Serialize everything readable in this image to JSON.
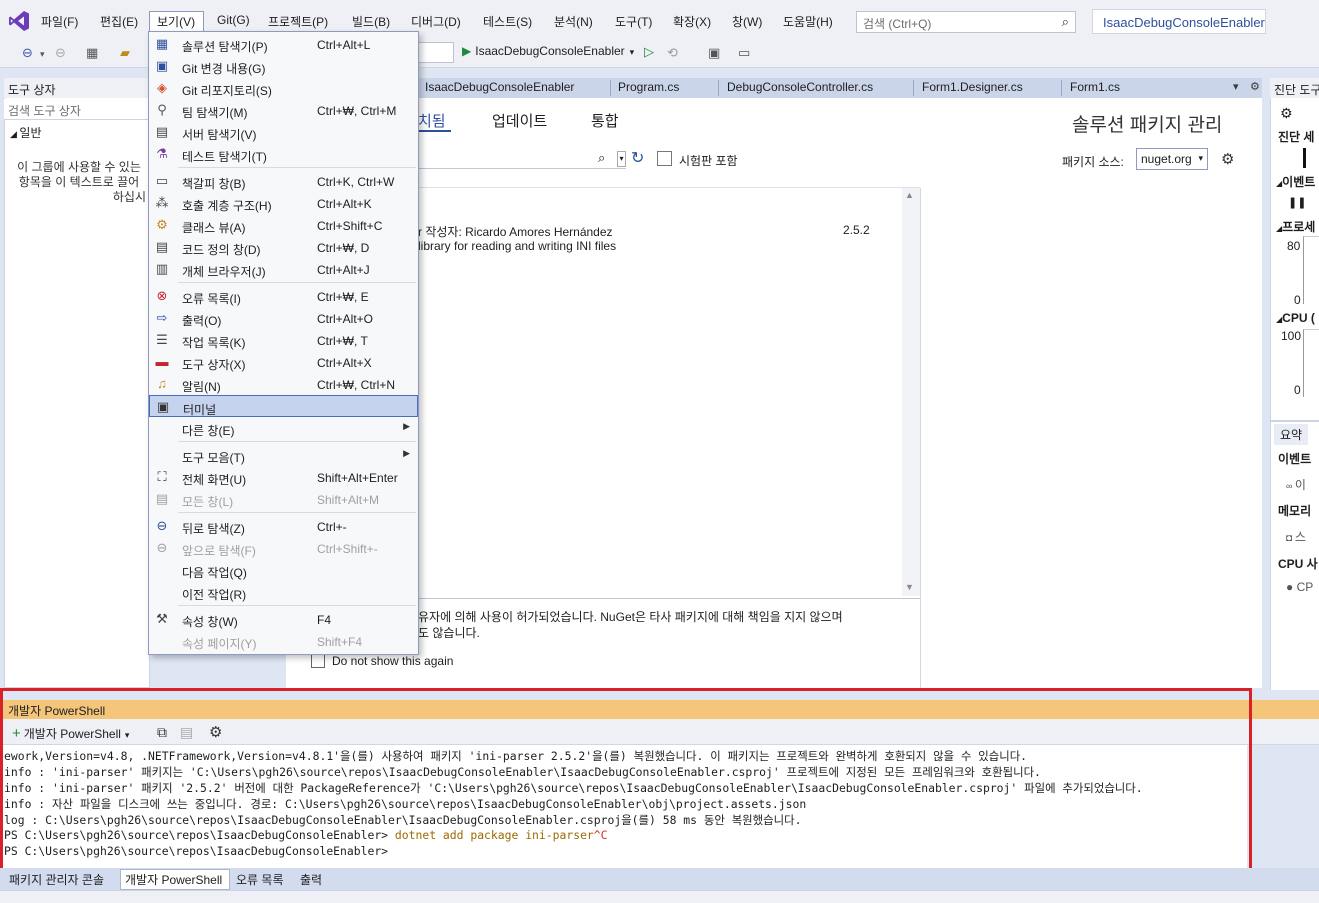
{
  "menubar": {
    "items": [
      "파일(F)",
      "편집(E)",
      "보기(V)",
      "Git(G)",
      "프로젝트(P)",
      "빌드(B)",
      "디버그(D)",
      "테스트(S)",
      "분석(N)",
      "도구(T)",
      "확장(X)",
      "창(W)",
      "도움말(H)"
    ],
    "search_placeholder": "검색 (Ctrl+Q)",
    "solution_title": "IsaacDebugConsoleEnabler"
  },
  "toolbar": {
    "startup_project": "IsaacDebugConsoleEnabler"
  },
  "view_menu": {
    "items": [
      {
        "label": "솔루션 탐색기(P)",
        "shortcut": "Ctrl+Alt+L",
        "icon": "solution-explorer-icon"
      },
      {
        "label": "Git 변경 내용(G)",
        "shortcut": "",
        "icon": "git-changes-icon"
      },
      {
        "label": "Git 리포지토리(S)",
        "shortcut": "",
        "icon": "git-repository-icon"
      },
      {
        "label": "팀 탐색기(M)",
        "shortcut": "Ctrl+₩, Ctrl+M",
        "icon": "team-explorer-icon"
      },
      {
        "label": "서버 탐색기(V)",
        "shortcut": "",
        "icon": "server-explorer-icon"
      },
      {
        "label": "테스트 탐색기(T)",
        "shortcut": "",
        "icon": "test-explorer-icon"
      },
      {
        "label": "책갈피 창(B)",
        "shortcut": "Ctrl+K, Ctrl+W",
        "icon": "bookmark-icon"
      },
      {
        "label": "호출 계층 구조(H)",
        "shortcut": "Ctrl+Alt+K",
        "icon": "call-hierarchy-icon"
      },
      {
        "label": "클래스 뷰(A)",
        "shortcut": "Ctrl+Shift+C",
        "icon": "class-view-icon"
      },
      {
        "label": "코드 정의 창(D)",
        "shortcut": "Ctrl+₩, D",
        "icon": "code-definition-icon"
      },
      {
        "label": "개체 브라우저(J)",
        "shortcut": "Ctrl+Alt+J",
        "icon": "object-browser-icon"
      },
      {
        "label": "오류 목록(I)",
        "shortcut": "Ctrl+₩, E",
        "icon": "error-list-icon"
      },
      {
        "label": "출력(O)",
        "shortcut": "Ctrl+Alt+O",
        "icon": "output-icon"
      },
      {
        "label": "작업 목록(K)",
        "shortcut": "Ctrl+₩, T",
        "icon": "task-list-icon"
      },
      {
        "label": "도구 상자(X)",
        "shortcut": "Ctrl+Alt+X",
        "icon": "toolbox-icon"
      },
      {
        "label": "알림(N)",
        "shortcut": "Ctrl+₩, Ctrl+N",
        "icon": "bell-icon"
      },
      {
        "label": "터미널",
        "shortcut": "",
        "icon": "terminal-icon"
      },
      {
        "label": "다른 창(E)",
        "shortcut": "",
        "icon": ""
      },
      {
        "label": "도구 모음(T)",
        "shortcut": "",
        "icon": ""
      },
      {
        "label": "전체 화면(U)",
        "shortcut": "Shift+Alt+Enter",
        "icon": "fullscreen-icon"
      },
      {
        "label": "모든 창(L)",
        "shortcut": "Shift+Alt+M",
        "icon": "all-windows-icon"
      },
      {
        "label": "뒤로 탐색(Z)",
        "shortcut": "Ctrl+-",
        "icon": "navigate-back-icon"
      },
      {
        "label": "앞으로 탐색(F)",
        "shortcut": "Ctrl+Shift+-",
        "icon": "navigate-forward-icon"
      },
      {
        "label": "다음 작업(Q)",
        "shortcut": "",
        "icon": ""
      },
      {
        "label": "이전 작업(R)",
        "shortcut": "",
        "icon": ""
      },
      {
        "label": "속성 창(W)",
        "shortcut": "F4",
        "icon": "wrench-icon"
      },
      {
        "label": "속성 페이지(Y)",
        "shortcut": "Shift+F4",
        "icon": ""
      }
    ]
  },
  "toolbox": {
    "title": "도구 상자",
    "search_placeholder": "검색 도구 상자",
    "group": "일반",
    "empty_text_1": "이 그룹에 사용할 수 있는",
    "empty_text_2": "항목을 이 텍스트로 끌어",
    "empty_text_3": "하십시"
  },
  "doc_tabs": [
    "IsaacDebugConsoleEnabler",
    "Program.cs",
    "DebugConsoleController.cs",
    "Form1.Designer.cs",
    "Form1.cs"
  ],
  "nuget": {
    "tab_browse": "치됨",
    "tab_updates": "업데이트",
    "tab_consolidate": "통합",
    "title": "솔루션 패키지 관리",
    "prerelease_label": "시험판 포함",
    "source_label": "패키지 소스:",
    "source_value": "nuget.org",
    "package_author_line": "r 작성자: Ricardo Amores Hernández",
    "package_version": "2.5.2",
    "package_description": "library for reading and writing INI files",
    "notice_line_1": "유자에 의해 사용이 허가되었습니다. NuGet은 타사 패키지에 대해 책임을 지지 않으며",
    "notice_line_2": "도 않습니다.",
    "dont_show_label": "Do not show this again"
  },
  "diagnostics": {
    "title": "진단 도구",
    "session_label": "진단 세",
    "events_label": "이벤트",
    "process_label": "프로세",
    "axis_80": "80",
    "axis_0a": "0",
    "cpu_label": "CPU (",
    "axis_100": "100",
    "axis_0b": "0",
    "tab_summary": "요약",
    "section_events": "이벤트",
    "row_events": "이",
    "section_memory": "메모리",
    "row_memory": "스",
    "section_cpu": "CPU 사",
    "row_cpu": "CP"
  },
  "terminal": {
    "title": "개발자 PowerShell",
    "new_terminal_label": "개발자 PowerShell",
    "lines": [
      "ework,Version=v4.8, .NETFramework,Version=v4.8.1'을(를) 사용하여 패키지 'ini-parser 2.5.2'을(를) 복원했습니다. 이 패키지는 프로젝트와 완벽하게 호환되지 않을 수 있습니다.",
      "info : 'ini-parser' 패키지는 'C:\\Users\\pgh26\\source\\repos\\IsaacDebugConsoleEnabler\\IsaacDebugConsoleEnabler.csproj' 프로젝트에 지정된 모든 프레임워크와 호환됩니다.",
      "info : 'ini-parser' 패키지 '2.5.2' 버전에 대한 PackageReference가 'C:\\Users\\pgh26\\source\\repos\\IsaacDebugConsoleEnabler\\IsaacDebugConsoleEnabler.csproj' 파일에 추가되었습니다.",
      "info : 자산 파일을 디스크에 쓰는 중입니다. 경로: C:\\Users\\pgh26\\source\\repos\\IsaacDebugConsoleEnabler\\obj\\project.assets.json",
      "log  : C:\\Users\\pgh26\\source\\repos\\IsaacDebugConsoleEnabler\\IsaacDebugConsoleEnabler.csproj을(를) 58 ms 동안 복원했습니다."
    ],
    "prompt_1": "PS C:\\Users\\pgh26\\source\\repos\\IsaacDebugConsoleEnabler> ",
    "command_1": "dotnet add package ini-parser",
    "ctrl_c": "^C",
    "prompt_2": "PS C:\\Users\\pgh26\\source\\repos\\IsaacDebugConsoleEnabler>"
  },
  "bottom_tabs": [
    "패키지 관리자 콘솔",
    "개발자 PowerShell",
    "오류 목록",
    "출력"
  ],
  "colors": {
    "accent": "#2d4f9e",
    "highlight_frame": "#d8222a",
    "terminal_title_bg": "#f5c67a",
    "menu_highlight": "#c6d3ef"
  }
}
